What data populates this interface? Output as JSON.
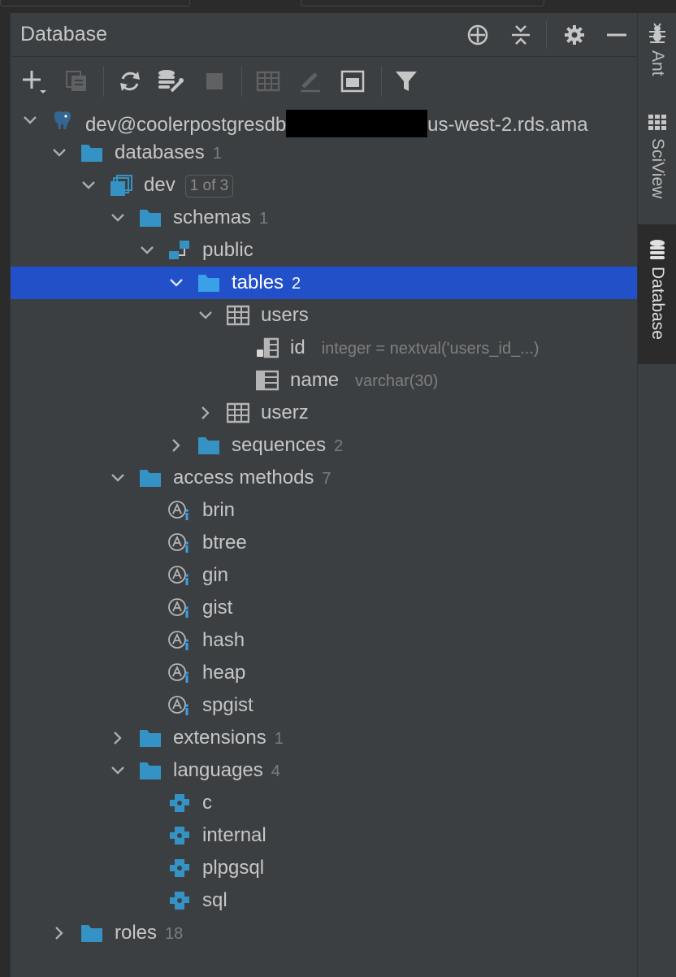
{
  "panel": {
    "title": "Database"
  },
  "side_tabs": [
    {
      "label": "Ant",
      "icon": "ant-icon"
    },
    {
      "label": "SciView",
      "icon": "sciview-icon"
    },
    {
      "label": "Database",
      "icon": "database-icon",
      "active": true
    }
  ],
  "tree": {
    "connection": {
      "prefix": "dev@coolerpostgresdb",
      "suffix": "us-west-2.rds.ama"
    },
    "databases": {
      "label": "databases",
      "count": "1"
    },
    "dev": {
      "label": "dev",
      "badge": "1 of 3"
    },
    "schemas": {
      "label": "schemas",
      "count": "1"
    },
    "public": {
      "label": "public"
    },
    "tables": {
      "label": "tables",
      "count": "2"
    },
    "users": {
      "label": "users"
    },
    "col_id": {
      "label": "id",
      "detail": "integer = nextval('users_id_...)"
    },
    "col_name": {
      "label": "name",
      "detail": "varchar(30)"
    },
    "userz": {
      "label": "userz"
    },
    "sequences": {
      "label": "sequences",
      "count": "2"
    },
    "access_methods": {
      "label": "access methods",
      "count": "7",
      "items": [
        "brin",
        "btree",
        "gin",
        "gist",
        "hash",
        "heap",
        "spgist"
      ]
    },
    "extensions": {
      "label": "extensions",
      "count": "1"
    },
    "languages": {
      "label": "languages",
      "count": "4",
      "items": [
        "c",
        "internal",
        "plpgsql",
        "sql"
      ]
    },
    "roles": {
      "label": "roles",
      "count": "18"
    }
  },
  "colors": {
    "selection": "#2150c9",
    "folder": "#3592c4",
    "panel": "#3c3f41",
    "background": "#2b2b2b"
  }
}
